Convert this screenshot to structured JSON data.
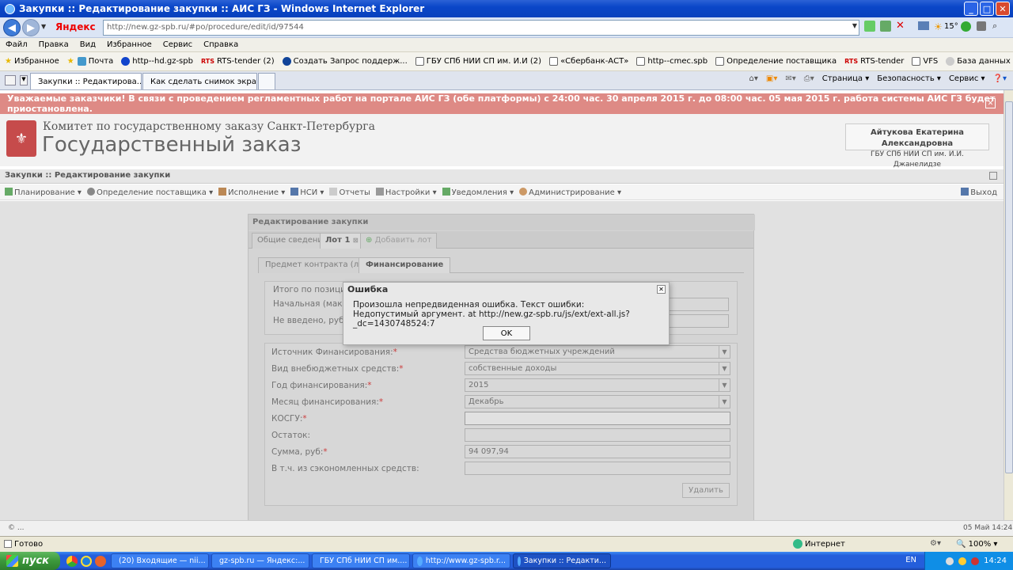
{
  "window": {
    "title": "Закупки :: Редактирование закупки :: АИС ГЗ - Windows Internet Explorer"
  },
  "address": {
    "brand": "Яндекс",
    "url": "http://new.gz-spb.ru/#po/procedure/edit/id/97544"
  },
  "menu": [
    "Файл",
    "Правка",
    "Вид",
    "Избранное",
    "Сервис",
    "Справка"
  ],
  "favorites": {
    "label": "Избранное",
    "items": [
      "Почта",
      "http--hd.gz-spb",
      "RTS-tender (2)",
      "Создать Запрос поддерж...",
      "ГБУ СПб НИИ СП им. И.И (2)",
      "«Сбербанк-АСТ»",
      "http--cmec.spb",
      "Определение поставщика",
      "RTS-tender",
      "VFS",
      "База данных «Учет собст..."
    ]
  },
  "browser_tabs": [
    "Закупки :: Редактирова...",
    "Как сделать снимок экрана..."
  ],
  "commands": [
    "Страница ▾",
    "Безопасность ▾",
    "Сервис ▾"
  ],
  "alert": "Уважаемые заказчики! В связи с проведением регламентных работ на портале АИС ГЗ (обе платформы) с 24:00 час. 30 апреля 2015 г. до 08:00 час. 05 мая 2015 г. работа системы АИС ГЗ будет приостановлена.",
  "header": {
    "org_line1": "Комитет по государственному заказу Санкт-Петербурга",
    "org_line2": "Государственный заказ",
    "user_name": "Айтукова Екатерина Александровна",
    "user_org": "ГБУ СПб НИИ СП им. И.И. Джанелидзе"
  },
  "page_title": "Закупки :: Редактирование закупки",
  "app_menu": [
    "Планирование ▾",
    "Определение поставщика ▾",
    "Исполнение ▾",
    "НСИ ▾",
    "Отчеты",
    "Настройки ▾",
    "Уведомления ▾",
    "Администрирование ▾"
  ],
  "exit_label": "Выход",
  "panel": {
    "title": "Редактирование закупки",
    "tabs": [
      "Общие сведения",
      "Лот 1",
      "Добавить лот"
    ],
    "subtabs": [
      "Предмет контракта (лота)",
      "Финансирование"
    ],
    "summary_labels": [
      "Итого по позициям",
      "Начальная (максим",
      "Не введено, руб.:"
    ],
    "fields": [
      {
        "label": "Источник Финансирования:",
        "required": "*",
        "value": "Средства бюджетных учреждений"
      },
      {
        "label": "Вид внебюджетных средств:",
        "required": "*",
        "value": "собственные доходы"
      },
      {
        "label": "Год финансирования:",
        "required": "*",
        "value": "2015"
      },
      {
        "label": "Месяц финансирования:",
        "required": "*",
        "value": "Декабрь"
      },
      {
        "label": "КОСГУ:",
        "required": "*",
        "value": ""
      },
      {
        "label": "Остаток:",
        "required": "",
        "value": ""
      },
      {
        "label": "Сумма, руб:",
        "required": "*",
        "value": "94 097,94"
      },
      {
        "label": "В т.ч. из сэкономленных средств:",
        "required": "",
        "value": ""
      }
    ],
    "delete_button": "Удалить"
  },
  "dialog": {
    "title": "Ошибка",
    "line1": "Произошла непредвиденная ошибка. Текст ошибки:",
    "line2": "Недопустимый аргумент. at http://new.gz-spb.ru/js/ext/ext-all.js?_dc=1430748524:7",
    "ok": "OK"
  },
  "app_status": {
    "left": "© ...",
    "right": "05 Май 14:24"
  },
  "ie_status": {
    "left": "Готово",
    "zone": "Интернет",
    "zoom": "100%"
  },
  "taskbar": {
    "start": "пуск",
    "tasks": [
      "(20) Входящие — nii...",
      "gz-spb.ru — Яндекс:...",
      "ГБУ СПб НИИ СП им....",
      "http://www.gz-spb.r...",
      "Закупки :: Редакти..."
    ],
    "lang": "EN",
    "time": "14:24"
  },
  "weather": "15°",
  "colors": {
    "alert_bg": "#de8a85",
    "xp_blue": "#0a46c8",
    "start_green": "#3c983c"
  }
}
